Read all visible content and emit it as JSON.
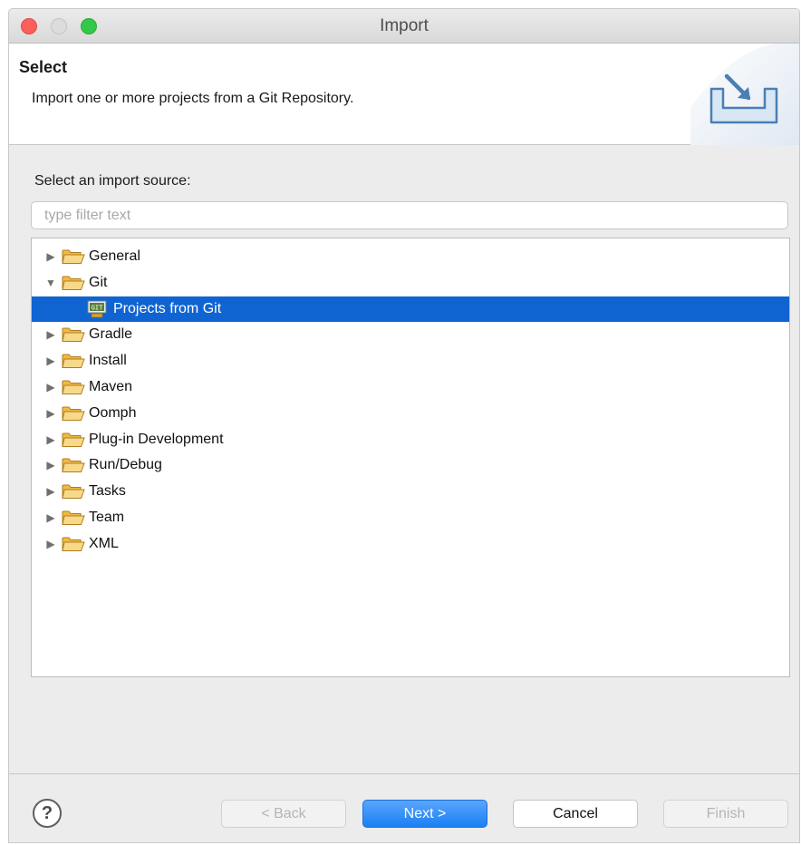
{
  "window": {
    "title": "Import"
  },
  "header": {
    "title": "Select",
    "description": "Import one or more projects from a Git Repository.",
    "banner_icon": "import-wizard-icon"
  },
  "main": {
    "source_label": "Select an import source:",
    "filter": {
      "value": "",
      "placeholder": "type filter text"
    },
    "tree": [
      {
        "label": "General",
        "expanded": false,
        "icon": "folder-icon"
      },
      {
        "label": "Git",
        "expanded": true,
        "icon": "folder-icon"
      },
      {
        "label": "Projects from Git",
        "child": true,
        "selected": true,
        "icon": "git-repo-icon"
      },
      {
        "label": "Gradle",
        "expanded": false,
        "icon": "folder-icon"
      },
      {
        "label": "Install",
        "expanded": false,
        "icon": "folder-icon"
      },
      {
        "label": "Maven",
        "expanded": false,
        "icon": "folder-icon"
      },
      {
        "label": "Oomph",
        "expanded": false,
        "icon": "folder-icon"
      },
      {
        "label": "Plug-in Development",
        "expanded": false,
        "icon": "folder-icon"
      },
      {
        "label": "Run/Debug",
        "expanded": false,
        "icon": "folder-icon"
      },
      {
        "label": "Tasks",
        "expanded": false,
        "icon": "folder-icon"
      },
      {
        "label": "Team",
        "expanded": false,
        "icon": "folder-icon"
      },
      {
        "label": "XML",
        "expanded": false,
        "icon": "folder-icon"
      }
    ]
  },
  "footer": {
    "help_label": "?",
    "back_label": "< Back",
    "next_label": "Next >",
    "cancel_label": "Cancel",
    "finish_label": "Finish"
  },
  "colors": {
    "selection": "#0f64d2",
    "primary_button": "#1a80f4",
    "folder": "#f5c96a"
  }
}
